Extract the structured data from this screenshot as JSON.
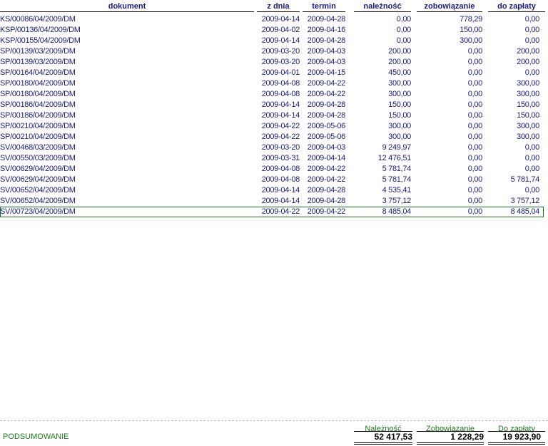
{
  "header": {
    "dokument": "dokument",
    "z_dnia": "z dnia",
    "termin": "termin",
    "naleznosc": "należność",
    "zobowiazanie": "zobowiązanie",
    "do_zaplaty": "do zapłaty"
  },
  "rows": [
    {
      "doc": "KS/00086/04/2009/DM",
      "zdnia": "2009-04-14",
      "termin": "2009-04-28",
      "nal": "0,00",
      "zob": "778,29",
      "doz": "0,00"
    },
    {
      "doc": "KSP/00136/04/2009/DM",
      "zdnia": "2009-04-02",
      "termin": "2009-04-16",
      "nal": "0,00",
      "zob": "150,00",
      "doz": "0,00"
    },
    {
      "doc": "KSP/00155/04/2009/DM",
      "zdnia": "2009-04-14",
      "termin": "2009-04-28",
      "nal": "0,00",
      "zob": "300,00",
      "doz": "0,00"
    },
    {
      "doc": "SP/00139/03/2009/DM",
      "zdnia": "2009-03-20",
      "termin": "2009-04-03",
      "nal": "200,00",
      "zob": "0,00",
      "doz": "200,00"
    },
    {
      "doc": "SP/00139/03/2009/DM",
      "zdnia": "2009-03-20",
      "termin": "2009-04-03",
      "nal": "200,00",
      "zob": "0,00",
      "doz": "200,00"
    },
    {
      "doc": "SP/00164/04/2009/DM",
      "zdnia": "2009-04-01",
      "termin": "2009-04-15",
      "nal": "450,00",
      "zob": "0,00",
      "doz": "0,00"
    },
    {
      "doc": "SP/00180/04/2009/DM",
      "zdnia": "2009-04-08",
      "termin": "2009-04-22",
      "nal": "300,00",
      "zob": "0,00",
      "doz": "300,00"
    },
    {
      "doc": "SP/00180/04/2009/DM",
      "zdnia": "2009-04-08",
      "termin": "2009-04-22",
      "nal": "300,00",
      "zob": "0,00",
      "doz": "300,00"
    },
    {
      "doc": "SP/00186/04/2009/DM",
      "zdnia": "2009-04-14",
      "termin": "2009-04-28",
      "nal": "150,00",
      "zob": "0,00",
      "doz": "150,00"
    },
    {
      "doc": "SP/00186/04/2009/DM",
      "zdnia": "2009-04-14",
      "termin": "2009-04-28",
      "nal": "150,00",
      "zob": "0,00",
      "doz": "150,00"
    },
    {
      "doc": "SP/00210/04/2009/DM",
      "zdnia": "2009-04-22",
      "termin": "2009-05-06",
      "nal": "300,00",
      "zob": "0,00",
      "doz": "300,00"
    },
    {
      "doc": "SP/00210/04/2009/DM",
      "zdnia": "2009-04-22",
      "termin": "2009-05-06",
      "nal": "300,00",
      "zob": "0,00",
      "doz": "300,00"
    },
    {
      "doc": "SV/00468/03/2009/DM",
      "zdnia": "2009-03-20",
      "termin": "2009-04-03",
      "nal": "9 249,97",
      "zob": "0,00",
      "doz": "0,00"
    },
    {
      "doc": "SV/00550/03/2009/DM",
      "zdnia": "2009-03-31",
      "termin": "2009-04-14",
      "nal": "12 476,51",
      "zob": "0,00",
      "doz": "0,00"
    },
    {
      "doc": "SV/00629/04/2009/DM",
      "zdnia": "2009-04-08",
      "termin": "2009-04-22",
      "nal": "5 781,74",
      "zob": "0,00",
      "doz": "0,00"
    },
    {
      "doc": "SV/00629/04/2009/DM",
      "zdnia": "2009-04-08",
      "termin": "2009-04-22",
      "nal": "5 781,74",
      "zob": "0,00",
      "doz": "5 781,74"
    },
    {
      "doc": "SV/00652/04/2009/DM",
      "zdnia": "2009-04-14",
      "termin": "2009-04-28",
      "nal": "4 535,41",
      "zob": "0,00",
      "doz": "0,00"
    },
    {
      "doc": "SV/00652/04/2009/DM",
      "zdnia": "2009-04-14",
      "termin": "2009-04-28",
      "nal": "3 757,12",
      "zob": "0,00",
      "doz": "3 757,12"
    },
    {
      "doc": "SV/00723/04/2009/DM",
      "zdnia": "2009-04-22",
      "termin": "2009-04-22",
      "nal": "8 485,04",
      "zob": "0,00",
      "doz": "8 485,04",
      "selected": true
    }
  ],
  "summary": {
    "title": "PODSUMOWANIE",
    "naleznosc_label": "Należność",
    "zobowiazanie_label": "Zobowiązanie",
    "do_zaplaty_label": "Do zapłaty",
    "naleznosc": "52 417,53",
    "zobowiazanie": "1 228,29",
    "do_zaplaty": "19 923,90"
  },
  "colors": {
    "text": "#1a1a80",
    "summary": "#1a7a1a",
    "selection": "#1a7a1a"
  }
}
